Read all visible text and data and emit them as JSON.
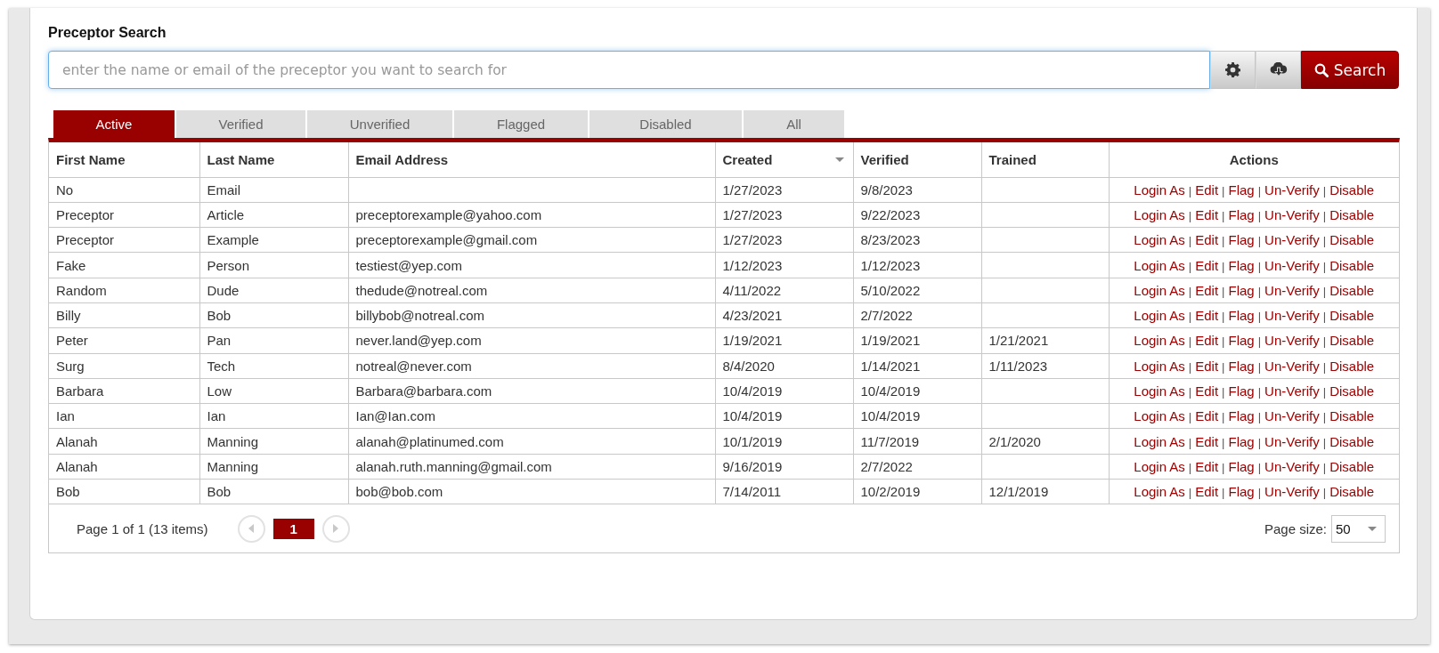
{
  "title": "Preceptor Search",
  "search": {
    "placeholder": "enter the name or email of the preceptor you want to search for",
    "focused": true,
    "button": "Search"
  },
  "tabs": [
    {
      "label": "Active",
      "selected": true
    },
    {
      "label": "Verified",
      "selected": false
    },
    {
      "label": "Unverified",
      "selected": false
    },
    {
      "label": "Flagged",
      "selected": false
    },
    {
      "label": "Disabled",
      "selected": false
    },
    {
      "label": "All",
      "selected": false
    }
  ],
  "table": {
    "columns": [
      {
        "label": "First Name",
        "sorted": false
      },
      {
        "label": "Last Name",
        "sorted": false
      },
      {
        "label": "Email Address",
        "sorted": false
      },
      {
        "label": "Created",
        "sorted": true
      },
      {
        "label": "Verified",
        "sorted": false
      },
      {
        "label": "Trained",
        "sorted": false
      },
      {
        "label": "Actions",
        "sorted": false
      }
    ],
    "action_separator": "|",
    "rows": [
      {
        "cells": [
          "No",
          "Email",
          null,
          "1/27/2023",
          "9/8/2023",
          null
        ],
        "actions": [
          "Login As",
          "Edit",
          "Flag",
          "Un-Verify",
          "Disable"
        ]
      },
      {
        "cells": [
          "Preceptor",
          "Article",
          "preceptorexample@yahoo.com",
          "1/27/2023",
          "9/22/2023",
          null
        ],
        "actions": [
          "Login As",
          "Edit",
          "Flag",
          "Un-Verify",
          "Disable"
        ]
      },
      {
        "cells": [
          "Preceptor",
          "Example",
          "preceptorexample@gmail.com",
          "1/27/2023",
          "8/23/2023",
          null
        ],
        "actions": [
          "Login As",
          "Edit",
          "Flag",
          "Un-Verify",
          "Disable"
        ]
      },
      {
        "cells": [
          "Fake",
          "Person",
          "testiest@yep.com",
          "1/12/2023",
          "1/12/2023",
          null
        ],
        "actions": [
          "Login As",
          "Edit",
          "Flag",
          "Un-Verify",
          "Disable"
        ]
      },
      {
        "cells": [
          "Random",
          "Dude",
          "thedude@notreal.com",
          "4/11/2022",
          "5/10/2022",
          null
        ],
        "actions": [
          "Login As",
          "Edit",
          "Flag",
          "Un-Verify",
          "Disable"
        ]
      },
      {
        "cells": [
          "Billy",
          "Bob",
          "billybob@notreal.com",
          "4/23/2021",
          "2/7/2022",
          null
        ],
        "actions": [
          "Login As",
          "Edit",
          "Flag",
          "Un-Verify",
          "Disable"
        ]
      },
      {
        "cells": [
          "Peter",
          "Pan",
          "never.land@yep.com",
          "1/19/2021",
          "1/19/2021",
          "1/21/2021"
        ],
        "actions": [
          "Login As",
          "Edit",
          "Flag",
          "Un-Verify",
          "Disable"
        ]
      },
      {
        "cells": [
          "Surg",
          "Tech",
          "notreal@never.com",
          "8/4/2020",
          "1/14/2021",
          "1/11/2023"
        ],
        "actions": [
          "Login As",
          "Edit",
          "Flag",
          "Un-Verify",
          "Disable"
        ]
      },
      {
        "cells": [
          "Barbara",
          "Low",
          "Barbara@barbara.com",
          "10/4/2019",
          "10/4/2019",
          null
        ],
        "actions": [
          "Login As",
          "Edit",
          "Flag",
          "Un-Verify",
          "Disable"
        ]
      },
      {
        "cells": [
          "Ian",
          "Ian",
          "Ian@Ian.com",
          "10/4/2019",
          "10/4/2019",
          null
        ],
        "actions": [
          "Login As",
          "Edit",
          "Flag",
          "Un-Verify",
          "Disable"
        ]
      },
      {
        "cells": [
          "Alanah",
          "Manning",
          "alanah@platinumed.com",
          "10/1/2019",
          "11/7/2019",
          "2/1/2020"
        ],
        "actions": [
          "Login As",
          "Edit",
          "Flag",
          "Un-Verify",
          "Disable"
        ]
      },
      {
        "cells": [
          "Alanah",
          "Manning",
          "alanah.ruth.manning@gmail.com",
          "9/16/2019",
          "2/7/2022",
          null
        ],
        "actions": [
          "Login As",
          "Edit",
          "Flag",
          "Un-Verify",
          "Disable"
        ]
      },
      {
        "cells": [
          "Bob",
          "Bob",
          "bob@bob.com",
          "7/14/2011",
          "10/2/2019",
          "12/1/2019"
        ],
        "actions": [
          "Login As",
          "Edit",
          "Flag",
          "Un-Verify",
          "Disable"
        ]
      }
    ]
  },
  "pager": {
    "summary": "Page 1 of 1 (13 items)",
    "prev_disabled": true,
    "next_disabled": true,
    "pages": [
      {
        "label": "1",
        "selected": true
      }
    ],
    "page_size_label": "Page size:",
    "page_size": "50"
  }
}
